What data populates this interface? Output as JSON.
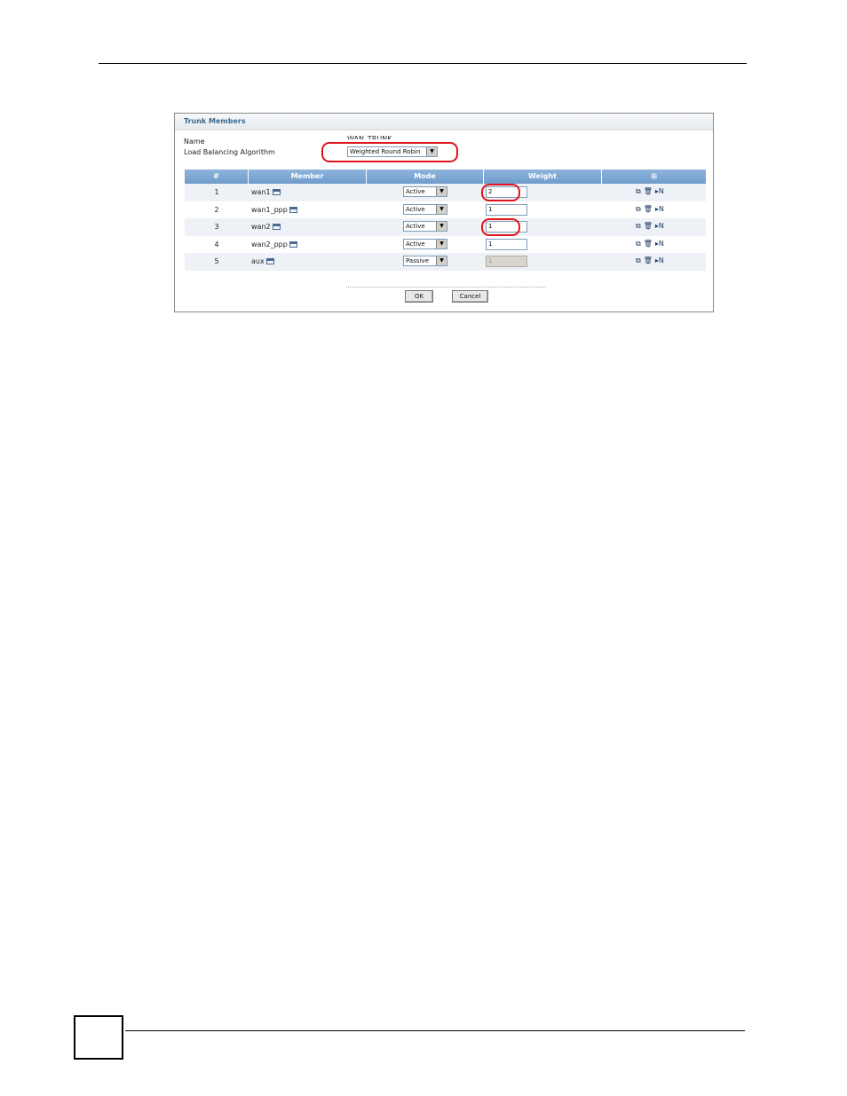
{
  "panel": {
    "title": "Trunk Members",
    "name_label": "Name",
    "name_value": "WAN_TRUNK",
    "algorithm_label": "Load Balancing Algorithm",
    "algorithm_value": "Weighted Round Robin"
  },
  "table": {
    "headers": [
      "#",
      "Member",
      "Mode",
      "Weight"
    ],
    "rows": [
      {
        "num": "1",
        "member": "wan1",
        "mode": "Active",
        "weight": "2",
        "disabled": false
      },
      {
        "num": "2",
        "member": "wan1_ppp",
        "mode": "Active",
        "weight": "1",
        "disabled": false
      },
      {
        "num": "3",
        "member": "wan2",
        "mode": "Active",
        "weight": "1",
        "disabled": false
      },
      {
        "num": "4",
        "member": "wan2_ppp",
        "mode": "Active",
        "weight": "1",
        "disabled": false
      },
      {
        "num": "5",
        "member": "aux",
        "mode": "Passive",
        "weight": "1",
        "disabled": true
      }
    ]
  },
  "buttons": {
    "ok": "OK",
    "cancel": "Cancel"
  },
  "colors": {
    "callout": "#e0141b",
    "header": "#7fa8d4"
  }
}
